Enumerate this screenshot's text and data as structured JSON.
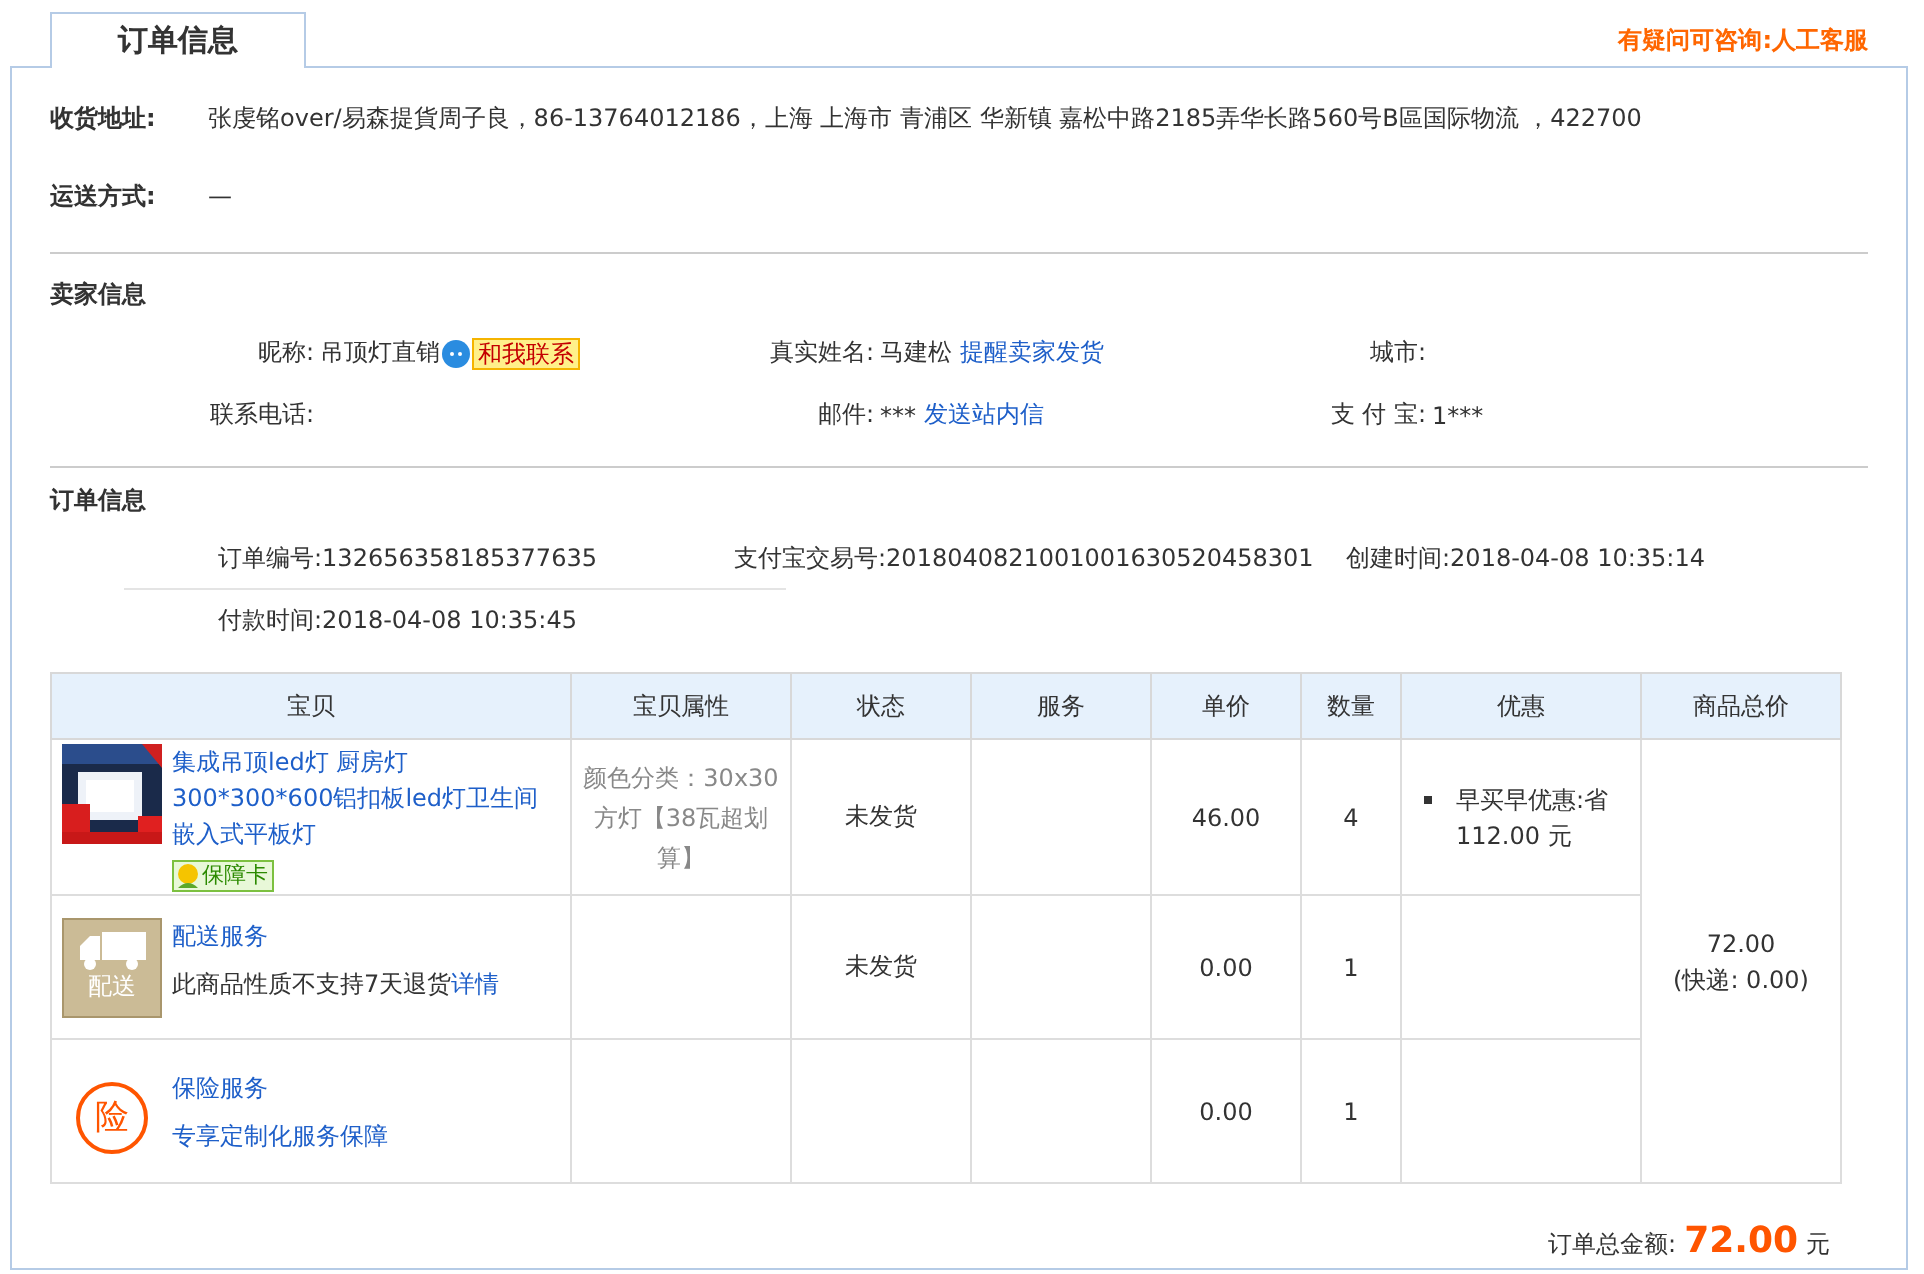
{
  "tabs": [
    {
      "label": "订单信息",
      "selected": true
    }
  ],
  "help_link": "有疑问可咨询:人工客服",
  "shipping": [
    {
      "label": "收货地址:",
      "value": "张虔铭over/易森提貨周子良，86-13764012186，上海 上海市 青浦区 华新镇 嘉松中路2185弄华长路560号B區国际物流 ，422700"
    },
    {
      "label": "运送方式:",
      "value": "—"
    }
  ],
  "seller": {
    "title": "卖家信息",
    "fields": [
      {
        "label": "昵称:",
        "value": "吊顶灯直销",
        "badge": "和我联系"
      },
      {
        "label": "真实姓名:",
        "value": "马建松",
        "link": "提醒卖家发货"
      },
      {
        "label": "城市:"
      },
      {
        "label": "联系电话:"
      },
      {
        "label": "邮件:",
        "value": "***",
        "link": "发送站内信"
      },
      {
        "label": "支 付 宝:",
        "value": "1***"
      }
    ]
  },
  "order": {
    "title": "订单信息",
    "fields": [
      "订单编号:132656358185377635",
      "支付宝交易号:2018040821001001630520458301",
      "创建时间:2018-04-08 10:35:14",
      "付款时间:2018-04-08 10:35:45"
    ]
  },
  "table": {
    "columns": [
      "宝贝",
      "宝贝属性",
      "状态",
      "服务",
      "单价",
      "数量",
      "优惠",
      "商品总价"
    ],
    "rows": [
      {
        "kind": "product",
        "title": "集成吊顶led灯 厨房灯300*300*600铝扣板led灯卫生间嵌入式平板灯",
        "badge": "保障卡",
        "attributes": "颜色分类：30x30方灯【38瓦超划算】",
        "status": "未发货",
        "price": "46.00",
        "quantity": "4",
        "discounts": [
          "早买早优惠:省 112.00 元"
        ]
      },
      {
        "kind": "delivery",
        "icon_label": "配送",
        "title": "配送服务",
        "note": "此商品性质不支持7天退货",
        "link": "详情",
        "status": "未发货",
        "price": "0.00",
        "quantity": "1"
      },
      {
        "kind": "insurance",
        "icon_label": "险",
        "title": "保险服务",
        "link": "专享定制化服务保障",
        "price": "0.00",
        "quantity": "1"
      }
    ],
    "total": "72.00",
    "shipping_fee": "(快递: 0.00)"
  },
  "footer": {
    "label": "订单总金额:",
    "amount": "72.00",
    "unit": "元"
  }
}
